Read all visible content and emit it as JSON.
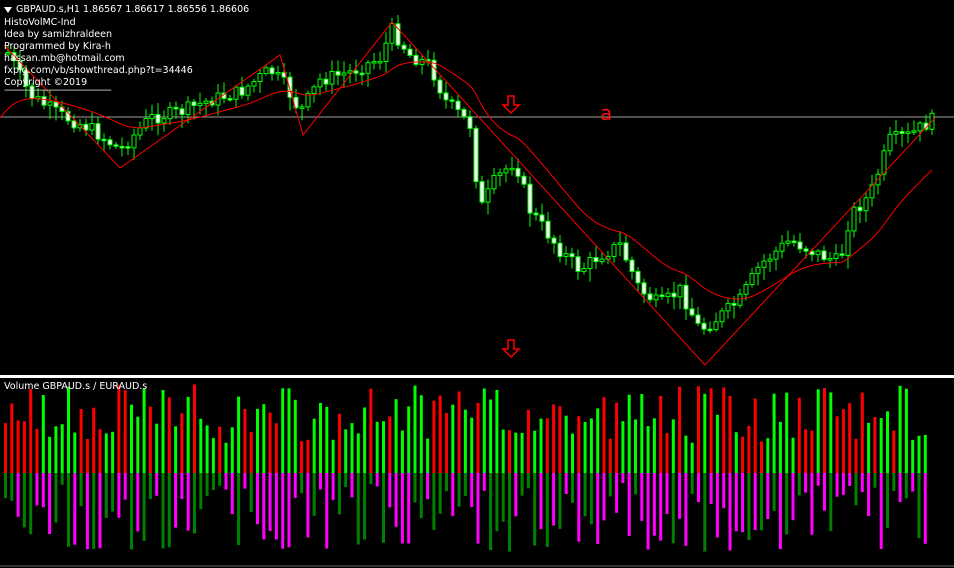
{
  "main_chart": {
    "symbol_line": "GBPAUD.s,H1  1.86567 1.86617 1.86556 1.86606",
    "info_lines": [
      "HistoVolMC-Ind",
      "Idea by samizhraldeen",
      "Programmed by Kira-h",
      "hassan.mb@hotmail.com",
      "fxpig.com/vb/showthread.php?t=34446",
      "Copyright ©2019"
    ],
    "separator": "--------------------------------------------",
    "marker_label": "a",
    "colors": {
      "background": "#000000",
      "bull_candle": "#00ff00",
      "bear_candle": "#00ff00",
      "candle_body_bear": "#ffffff",
      "moving_average": "#ff0000",
      "zigzag": "#ff0000",
      "horizontal_level": "#a0a0a0",
      "arrow": "#ff0000"
    },
    "icons": [
      "down-arrow-icon",
      "down-arrow-icon"
    ]
  },
  "volume_panel": {
    "title": "Volume GBPAUD.s / EURAUD.s",
    "colors": {
      "up_green": "#00ff00",
      "up_red": "#ff0000",
      "down_darkgreen": "#008000",
      "down_magenta": "#ff00ff"
    }
  }
}
